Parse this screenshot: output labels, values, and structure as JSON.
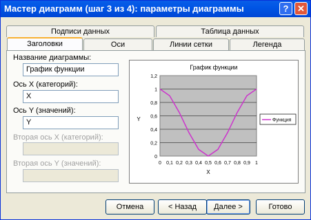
{
  "window": {
    "title": "Мастер диаграмм (шаг 3 из 4): параметры диаграммы",
    "help": "?",
    "close": "✕"
  },
  "tabs_back": [
    "Подписи данных",
    "Таблица данных"
  ],
  "tabs_front": [
    "Заголовки",
    "Оси",
    "Линии сетки",
    "Легенда"
  ],
  "form": {
    "chart_title_label": "Название диаграммы:",
    "chart_title_value": "График функции",
    "x_axis_label": "Ось X (категорий):",
    "x_axis_value": "X",
    "y_axis_label": "Ось Y (значений):",
    "y_axis_value": "Y",
    "x2_axis_label": "Вторая ось X (категорий):",
    "y2_axis_label": "Вторая ось Y (значений):"
  },
  "buttons": {
    "cancel": "Отмена",
    "back": "< Назад",
    "next": "Далее >",
    "finish": "Готово"
  },
  "colors": {
    "series": "#cc33cc",
    "plot_bg": "#c0c0c0"
  },
  "chart_data": {
    "type": "line",
    "title": "График функции",
    "xlabel": "X",
    "ylabel": "Y",
    "x": [
      0,
      0.1,
      0.2,
      0.3,
      0.4,
      0.5,
      0.6,
      0.7,
      0.8,
      0.9,
      1
    ],
    "series": [
      {
        "name": "Функция",
        "values": [
          1,
          0.9,
          0.65,
          0.35,
          0.1,
          0,
          0.1,
          0.35,
          0.65,
          0.9,
          1
        ]
      }
    ],
    "y_ticks": [
      "0",
      "0,2",
      "0,4",
      "0,6",
      "0,8",
      "1",
      "1,2"
    ],
    "x_ticks": [
      "0",
      "0,1",
      "0,2",
      "0,3",
      "0,4",
      "0,5",
      "0,6",
      "0,7",
      "0,8",
      "0,9",
      "1"
    ],
    "ylim": [
      0,
      1.2
    ],
    "grid": true,
    "legend": "right"
  }
}
